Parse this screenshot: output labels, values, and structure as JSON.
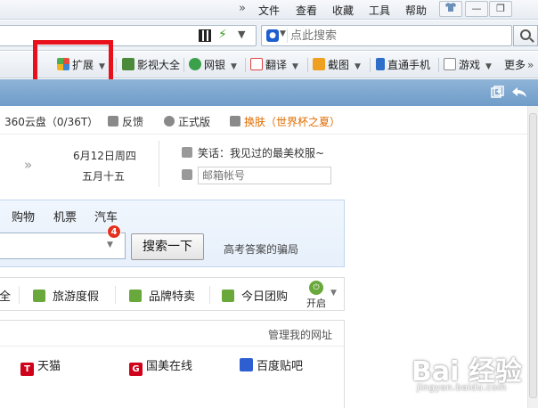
{
  "menubar": {
    "overflow_chevron": "»",
    "menus": [
      "文件",
      "查看",
      "收藏",
      "工具",
      "帮助"
    ],
    "window_buttons": [
      "skin",
      "minimize",
      "restore"
    ]
  },
  "address": {
    "search_placeholder": "点此搜索"
  },
  "ext_toolbar": {
    "items": [
      {
        "label": "扩展",
        "icon": "extension-icon",
        "dropdown": true
      },
      {
        "label": "影视大全",
        "icon": "video-icon",
        "dropdown": false
      },
      {
        "label": "网银",
        "icon": "bank-icon",
        "dropdown": true
      },
      {
        "label": "翻译",
        "icon": "translate-icon",
        "dropdown": true
      },
      {
        "label": "截图",
        "icon": "screenshot-icon",
        "dropdown": true
      },
      {
        "label": "直通手机",
        "icon": "phone-icon",
        "dropdown": false
      },
      {
        "label": "游戏",
        "icon": "game-icon",
        "dropdown": true
      },
      {
        "label": "更多",
        "icon": "",
        "dropdown": false
      }
    ],
    "highlight_color": "#e8101a"
  },
  "page": {
    "topbar": {
      "cloud": "360云盘（0/36T）",
      "feedback": "反馈",
      "official": "正式版",
      "skin": "换肤（世界杯之夏）"
    },
    "date": {
      "solar": "6月12日周四",
      "lunar": "五月十五",
      "chevrons": "»"
    },
    "joke": "笑话：我见过的最美校服~",
    "mail_placeholder": "邮箱帐号",
    "search_categories": [
      "购物",
      "机票",
      "汽车"
    ],
    "search_badge": "4",
    "search_button": "搜索一下",
    "hot_query": "高考答案的骗局",
    "nav": [
      "全",
      "旅游度假",
      "品牌特卖",
      "今日团购"
    ],
    "nav_open": "开启",
    "manage_sites": "管理我的网址",
    "sites": [
      {
        "label": "天猫",
        "icon_text": "T",
        "color": "#d0021b"
      },
      {
        "label": "国美在线",
        "icon_text": "G",
        "color": "#d0021b"
      },
      {
        "label": "百度贴吧",
        "icon_text": "",
        "color": "#2d5fd3"
      }
    ]
  },
  "watermark": {
    "brand": "Bai 经验",
    "url": "jingyan.baidu.com"
  }
}
